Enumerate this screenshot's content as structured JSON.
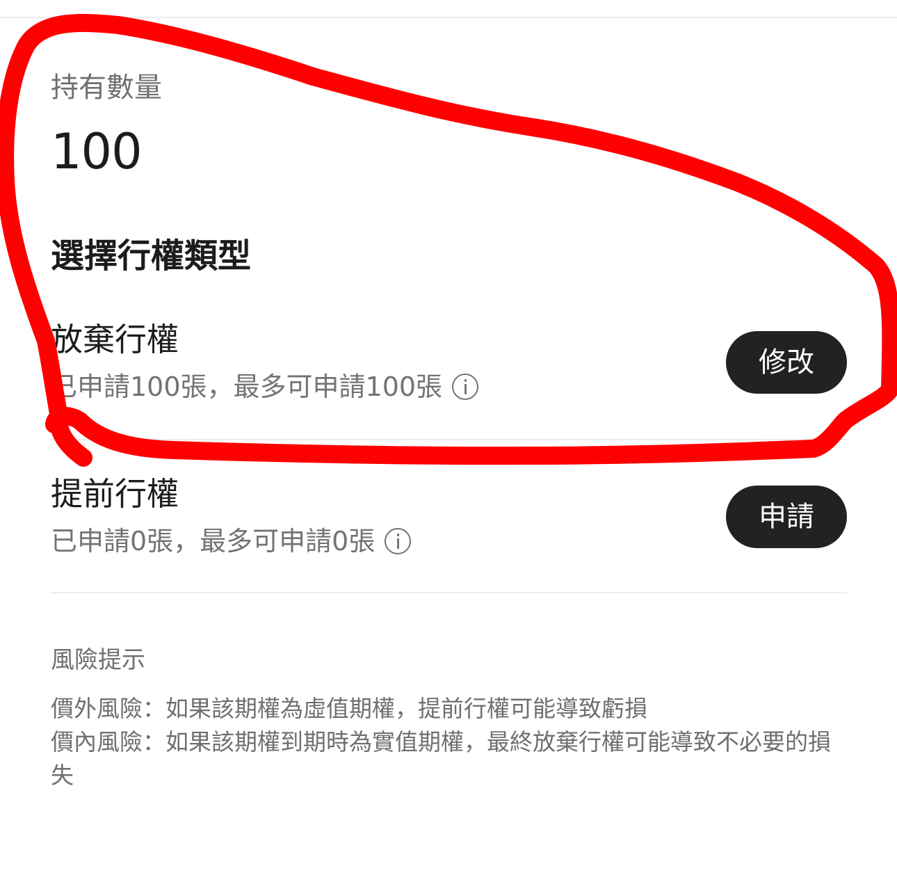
{
  "holding": {
    "label": "持有數量",
    "value": "100"
  },
  "exercise": {
    "section_title": "選擇行權類型",
    "options": [
      {
        "title": "放棄行權",
        "subtitle": "已申請100張，最多可申請100張",
        "button": "修改"
      },
      {
        "title": "提前行權",
        "subtitle": "已申請0張，最多可申請0張",
        "button": "申請"
      }
    ]
  },
  "risk": {
    "title": "風險提示",
    "lines": [
      "價外風險：如果該期權為虛值期權，提前行權可能導致虧損",
      "價內風險：如果該期權到期時為實值期權，最終放棄行權可能導致不必要的損失"
    ]
  },
  "annotation": {
    "color": "#ff0000"
  }
}
